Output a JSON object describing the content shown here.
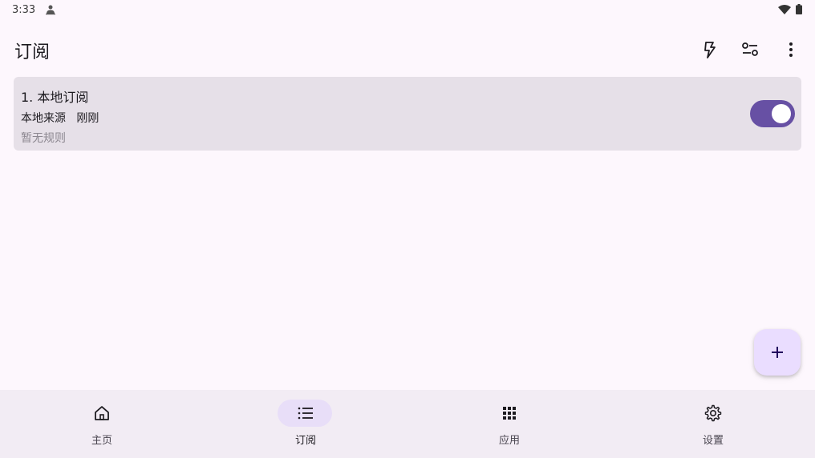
{
  "status_bar": {
    "time": "3:33",
    "icons": [
      "person-icon",
      "wifi-icon",
      "battery-icon"
    ]
  },
  "app_bar": {
    "title": "订阅",
    "actions": [
      "flash-icon",
      "filter-icon",
      "more-vert-icon"
    ]
  },
  "subscriptions": [
    {
      "title": "1. 本地订阅",
      "source": "本地来源",
      "updated": "刚刚",
      "rules": "暂无规则",
      "enabled": true
    }
  ],
  "fab": {
    "icon": "add-icon"
  },
  "bottom_nav": {
    "selected": "订阅",
    "items": [
      {
        "label": "主页",
        "icon": "home-icon"
      },
      {
        "label": "订阅",
        "icon": "list-icon"
      },
      {
        "label": "应用",
        "icon": "apps-grid-icon"
      },
      {
        "label": "设置",
        "icon": "settings-icon"
      }
    ]
  },
  "colors": {
    "background": "#fdf7fd",
    "card": "#e6e0e8",
    "accent": "#6750a4",
    "fab": "#eaddff",
    "nav_background": "#f2ecf4",
    "nav_indicator": "#e8def8"
  }
}
